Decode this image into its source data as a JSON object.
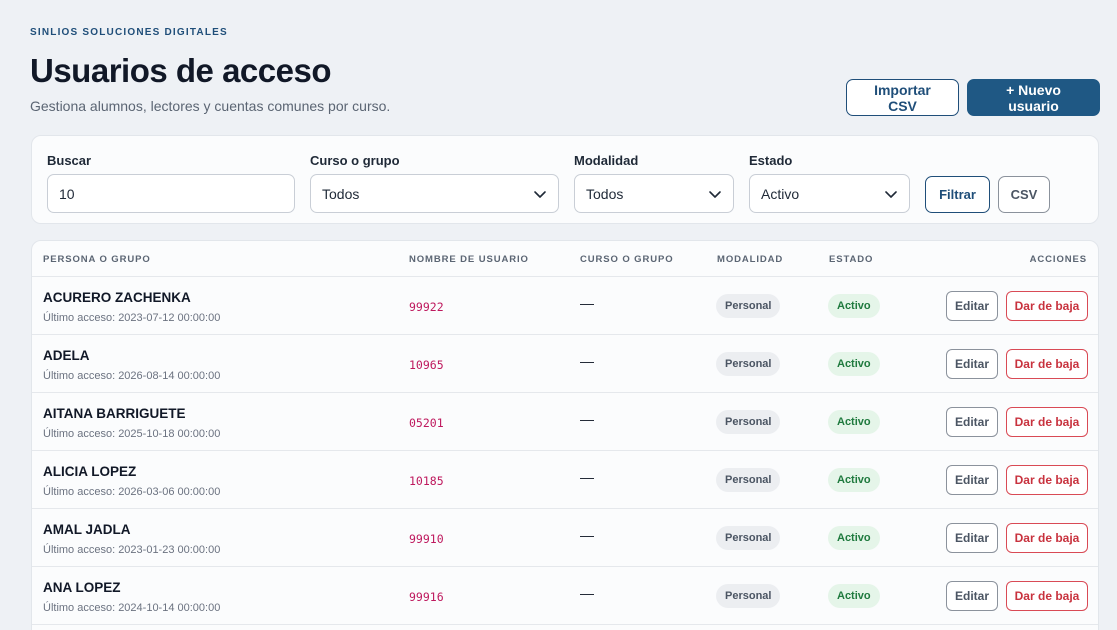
{
  "header": {
    "eyebrow": "SINLIOS SOLUCIONES DIGITALES",
    "title": "Usuarios de acceso",
    "subtitle": "Gestiona alumnos, lectores y cuentas comunes por curso.",
    "import_label": "Importar CSV",
    "new_label": "+ Nuevo usuario"
  },
  "filters": {
    "search_label": "Buscar",
    "search_value": "10",
    "course_label": "Curso o grupo",
    "course_value": "Todos",
    "mode_label": "Modalidad",
    "mode_value": "Todos",
    "state_label": "Estado",
    "state_value": "Activo",
    "filter_label": "Filtrar",
    "csv_label": "CSV"
  },
  "table": {
    "columns": {
      "person": "PERSONA O GRUPO",
      "username": "NOMBRE DE USUARIO",
      "course": "CURSO O GRUPO",
      "mode": "MODALIDAD",
      "state": "ESTADO",
      "actions": "ACCIONES"
    },
    "rows": [
      {
        "name": "ACURERO ZACHENKA",
        "last": "Último acceso: 2023-07-12 00:00:00",
        "user": "99922",
        "course": "—",
        "mode": "Personal",
        "state": "Activo",
        "edit": "Editar",
        "del": "Dar de baja"
      },
      {
        "name": "ADELA",
        "last": "Último acceso: 2026-08-14 00:00:00",
        "user": "10965",
        "course": "—",
        "mode": "Personal",
        "state": "Activo",
        "edit": "Editar",
        "del": "Dar de baja"
      },
      {
        "name": "AITANA BARRIGUETE",
        "last": "Último acceso: 2025-10-18 00:00:00",
        "user": "05201",
        "course": "—",
        "mode": "Personal",
        "state": "Activo",
        "edit": "Editar",
        "del": "Dar de baja"
      },
      {
        "name": "ALICIA LOPEZ",
        "last": "Último acceso: 2026-03-06 00:00:00",
        "user": "10185",
        "course": "—",
        "mode": "Personal",
        "state": "Activo",
        "edit": "Editar",
        "del": "Dar de baja"
      },
      {
        "name": "AMAL JADLA",
        "last": "Último acceso: 2023-01-23 00:00:00",
        "user": "99910",
        "course": "—",
        "mode": "Personal",
        "state": "Activo",
        "edit": "Editar",
        "del": "Dar de baja"
      },
      {
        "name": "ANA LOPEZ",
        "last": "Último acceso: 2024-10-14 00:00:00",
        "user": "99916",
        "course": "—",
        "mode": "Personal",
        "state": "Activo",
        "edit": "Editar",
        "del": "Dar de baja"
      }
    ]
  },
  "colors": {
    "primary": "#1f5884",
    "danger": "#c8323e",
    "active_bg": "#e5f5e9",
    "username": "#be185d"
  },
  "icons": {
    "select_chevron": "chevron-down-icon"
  }
}
